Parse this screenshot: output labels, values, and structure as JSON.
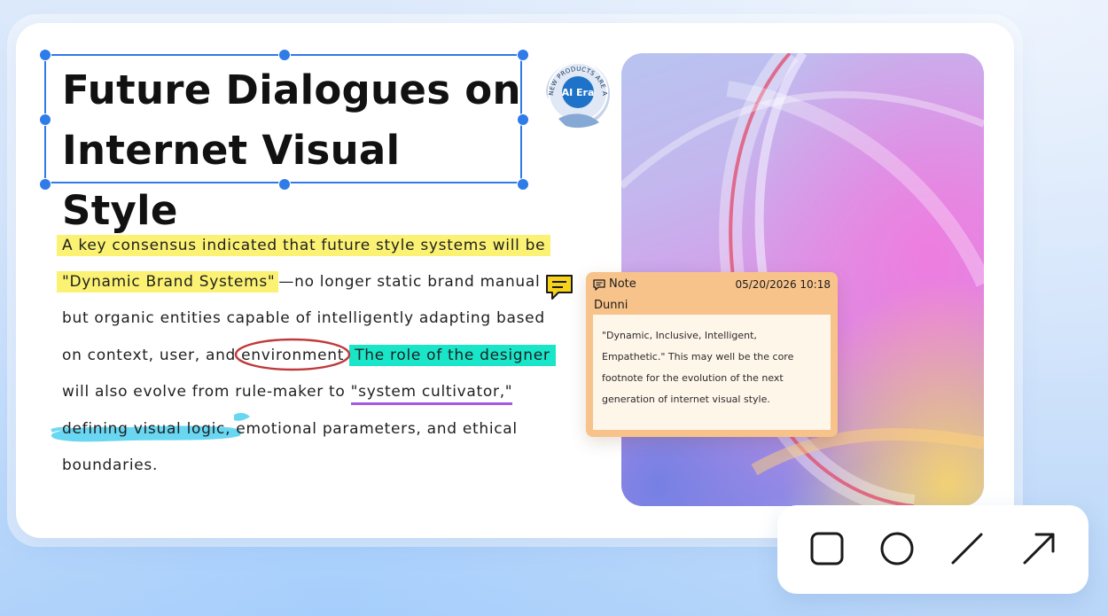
{
  "title": {
    "line1": "Future Dialogues on",
    "line2": "Internet Visual Style"
  },
  "sticker": {
    "arc_text": "NEW PRODUCTS ARE AVAILABLE",
    "center_text": "AI Era"
  },
  "paragraph": {
    "l1_hl": "A key consensus indicated that future style systems will be",
    "l2_hl": "\"Dynamic Brand Systems\"",
    "l2_rest": "—no longer static brand manual",
    "l3": "but organic entities capable of intelligently adapting based",
    "l4_pre": "on context, user, and ",
    "l4_circled": "environment.",
    "l4_hl": "The role of the designer",
    "l5_pre": "will also evolve from rule-maker to ",
    "l5_under": "\"system cultivator,\"",
    "l6_brush": "defining visual logic,",
    "l6_rest": " emotional parameters, and ethical",
    "l7": "boundaries."
  },
  "note": {
    "label": "Note",
    "date": "05/20/2026 10:18",
    "author": "Dunni",
    "body": "\"Dynamic, Inclusive, Intelligent, Empathetic.\" This may well be the core footnote for the evolution of the next generation of internet visual style."
  },
  "toolbar": {
    "tools": [
      "rectangle-icon",
      "circle-icon",
      "line-icon",
      "arrow-icon"
    ]
  },
  "colors": {
    "selection": "#2f7be8",
    "highlight_yellow": "#fbf273",
    "highlight_cyan": "#19e6c9",
    "underline_purple": "#a25be0",
    "ellipse_red": "#c0393b",
    "brush_cyan": "#4fd0ef",
    "note_bg": "#f7c38a"
  }
}
